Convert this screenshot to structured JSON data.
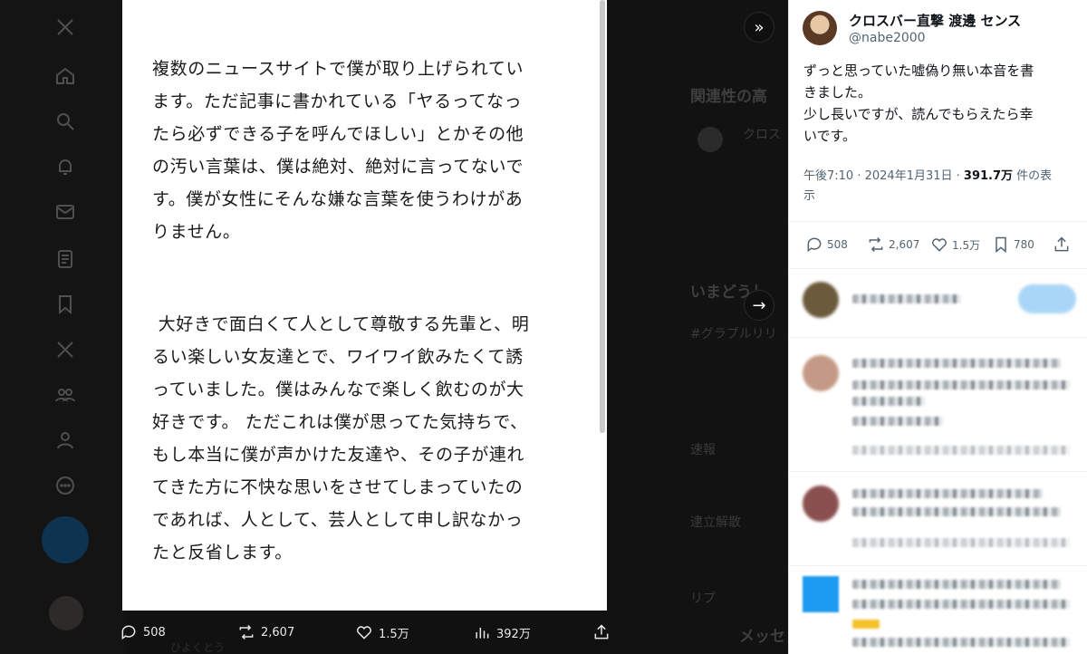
{
  "document": {
    "paragraph1": [
      "複数のニュースサイトで僕が取り上げられてい",
      "ます。ただ記事に書かれている「ヤるってなっ",
      "たら必ずできる子を呼んでほしい」とかその他",
      "の汚い言葉は、僕は絶対、絶対に言ってないで",
      "す。僕が女性にそんな嫌な言葉を使うわけがあ",
      "りません。"
    ],
    "paragraph2": [
      " 大好きで面白くて人として尊敬する先輩と、明",
      "るい楽しい女友達とで、ワイワイ飲みたくて誘",
      "っていました。僕はみんなで楽しく飲むのが大",
      "好きです。 ただこれは僕が思ってた気持ちで、",
      "もし本当に僕が声かけた友達や、その子が連れ",
      "てきた方に不快な思いをさせてしまっていたの",
      "であれば、人として、芸人として申し訳なかっ",
      "たと反省します。"
    ]
  },
  "media_actions": {
    "replies": "508",
    "reposts": "2,607",
    "likes": "1.5万",
    "views": "392万"
  },
  "tweet": {
    "author_name": "クロスバー直撃 渡邊 センス",
    "author_handle": "@nabe2000",
    "text_lines": [
      "ずっと思っていた嘘偽り無い本音を書",
      "きました。",
      "少し長いですが、読んでもらえたら幸",
      "いです。"
    ],
    "time": "午後7:10",
    "date": "2024年1月31日",
    "views_count": "391.7万",
    "views_suffix": " 件の表",
    "views_suffix2": "示",
    "replies": "508",
    "reposts": "2,607",
    "likes": "1.5万",
    "bookmarks": "780"
  },
  "background": {
    "related_heading": "関連性の高",
    "trends_heading": "いまどうし",
    "trend_item": "#グラブルリリ",
    "messages": "メッセ",
    "faint_1": "クロス",
    "faint_2": "ひよくとう",
    "faint_3": "リプ",
    "faint_4": "速報",
    "faint_5": "逮立解散"
  },
  "colors": {
    "accent": "#1d9bf0",
    "panel_bg": "#ffffff",
    "overlay_bg": "#111111"
  }
}
